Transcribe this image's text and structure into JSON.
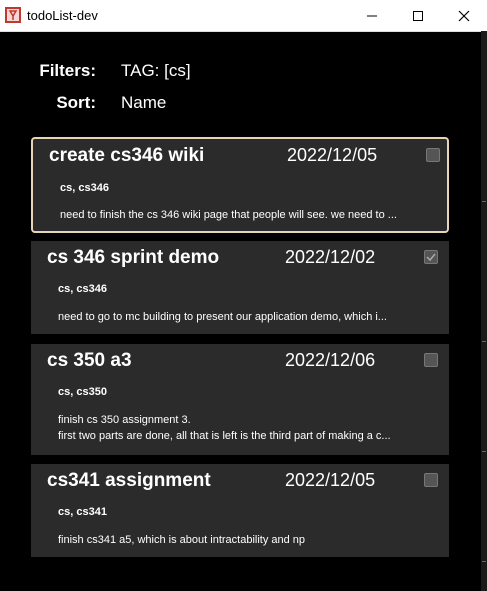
{
  "window": {
    "title": "todoList-dev"
  },
  "filters": {
    "label": "Filters:",
    "value": "TAG: [cs]"
  },
  "sort": {
    "label": "Sort:",
    "value": "Name"
  },
  "tasks": [
    {
      "title": "create cs346 wiki",
      "date": "2022/12/05",
      "checked": false,
      "selected": true,
      "tags": "cs, cs346",
      "description": [
        "need to finish the cs 346 wiki page that people will see. we need to ..."
      ]
    },
    {
      "title": "cs 346 sprint demo",
      "date": "2022/12/02",
      "checked": true,
      "selected": false,
      "tags": "cs, cs346",
      "description": [
        "need to go to mc building to present our application demo, which i..."
      ]
    },
    {
      "title": "cs 350 a3",
      "date": "2022/12/06",
      "checked": false,
      "selected": false,
      "tags": "cs, cs350",
      "description": [
        "finish cs 350 assignment 3.",
        "first two parts are done, all that is left is the third part of making a c..."
      ]
    },
    {
      "title": "cs341 assignment",
      "date": "2022/12/05",
      "checked": false,
      "selected": false,
      "tags": "cs, cs341",
      "description": [
        "finish cs341 a5, which is about intractability and np"
      ]
    }
  ]
}
